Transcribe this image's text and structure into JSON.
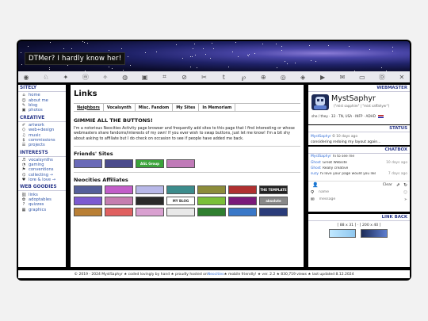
{
  "banner": {
    "title": "DTMer? I hardly know her!"
  },
  "iconbar": {
    "icons": [
      "globe-icon",
      "rabbit-icon",
      "butterfly-icon",
      "mastodon-icon",
      "twitter-icon",
      "dog-icon",
      "camera-icon",
      "crop-icon",
      "no-entry-icon",
      "scissors-icon",
      "tumblr-icon",
      "p-icon",
      "link-icon",
      "github-icon",
      "steam-icon",
      "youtube-icon",
      "chat-icon",
      "monitor-icon",
      "bell-icon",
      "x-icon"
    ],
    "glyphs": [
      "◉",
      "♘",
      "✦",
      "ⓜ",
      "✧",
      "◍",
      "▣",
      "⌗",
      "⊘",
      "✂",
      "t",
      "℘",
      "⊕",
      "◎",
      "◈",
      "▶",
      "✉",
      "▭",
      "Ⓓ",
      "✕"
    ]
  },
  "sidebar": {
    "sections": [
      {
        "title": "SITELY",
        "items": [
          {
            "icon": "home-icon",
            "glyph": "⌂",
            "label": "home"
          },
          {
            "icon": "about-icon",
            "glyph": "☺",
            "label": "about me"
          },
          {
            "icon": "blog-icon",
            "glyph": "✎",
            "label": "blog"
          },
          {
            "icon": "photos-icon",
            "glyph": "▣",
            "label": "photos"
          }
        ]
      },
      {
        "title": "CREATIVE",
        "items": [
          {
            "icon": "brush-icon",
            "glyph": "✐",
            "label": "artwork"
          },
          {
            "icon": "code-icon",
            "glyph": "⟨⟩",
            "label": "web+design"
          },
          {
            "icon": "music-icon",
            "glyph": "♫",
            "label": "music"
          },
          {
            "icon": "dollar-icon",
            "glyph": "$",
            "label": "commissions"
          },
          {
            "icon": "projects-icon",
            "glyph": "☰",
            "label": "projects"
          }
        ]
      },
      {
        "title": "INTERESTS",
        "items": [
          {
            "icon": "headphones-icon",
            "glyph": "♬",
            "label": "vocalsynths"
          },
          {
            "icon": "gamepad-icon",
            "glyph": "◔",
            "label": "gaming"
          },
          {
            "icon": "convention-icon",
            "glyph": "⚑",
            "label": "conventions"
          },
          {
            "icon": "collecting-icon",
            "glyph": "⌬",
            "label": "collecting →"
          },
          {
            "icon": "heart-icon",
            "glyph": "♥",
            "label": "lore & love →"
          }
        ]
      },
      {
        "title": "WEB GOODIES",
        "items": [
          {
            "icon": "links-icon",
            "glyph": "⛓",
            "label": "links"
          },
          {
            "icon": "adoptables-icon",
            "glyph": "✿",
            "label": "adoptables"
          },
          {
            "icon": "quizzes-icon",
            "glyph": "?",
            "label": "quizzes"
          },
          {
            "icon": "graphics-icon",
            "glyph": "▦",
            "label": "graphics"
          }
        ]
      }
    ]
  },
  "main": {
    "title": "Links",
    "tabs": [
      "Neighbors",
      "Vocalsynth",
      "Misc. Fandom",
      "My Sites",
      "In Memoriam"
    ],
    "heading": "GIMMIE ALL THE BUTTONS!",
    "para": "I'm a notorious Neocities Activity page browser and frequently add sites to this page that I find interesting or whose webmasters share fandoms/interests of my own! If you ever wish to swap buttons, just let me know! I'm a bit shy about asking to affiliate but I do check on occasion to see if people have added me back.",
    "friends_title": "Friends' Sites",
    "friends_buttons": [
      {
        "label": "",
        "color": "#6a6ab8"
      },
      {
        "label": "",
        "color": "#4b4b8c"
      },
      {
        "label": "AGL Group",
        "color": "#3aa33a"
      },
      {
        "label": "",
        "color": "#c07ab8"
      }
    ],
    "affiliates_title": "Neocities Affiliates",
    "affiliates_rows": [
      [
        {
          "label": "",
          "color": "#555f9a"
        },
        {
          "label": "",
          "color": "#c25ec9"
        },
        {
          "label": "",
          "color": "#b8b8e8"
        },
        {
          "label": "",
          "color": "#3c8c8c"
        },
        {
          "label": "",
          "color": "#8c8c3a"
        },
        {
          "label": "",
          "color": "#b03030"
        },
        {
          "label": "THE TEMPLATE",
          "color": "#222222"
        }
      ],
      [
        {
          "label": "",
          "color": "#7c5ad0"
        },
        {
          "label": "",
          "color": "#c57eb0"
        },
        {
          "label": "",
          "color": "#2a2a2a"
        },
        {
          "label": "MY BLOG",
          "color": "#ffffff"
        },
        {
          "label": "",
          "color": "#7abf38"
        },
        {
          "label": "",
          "color": "#7a1a7a"
        },
        {
          "label": "absolute",
          "color": "#888888"
        }
      ],
      [
        {
          "label": "",
          "color": "#b97f35"
        },
        {
          "label": "",
          "color": "#e06060"
        },
        {
          "label": "",
          "color": "#d9a0d0"
        },
        {
          "label": "",
          "color": "#e9e9e9"
        },
        {
          "label": "",
          "color": "#2f7f2f"
        },
        {
          "label": "",
          "color": "#3a78c8"
        },
        {
          "label": "",
          "color": "#2a3c7a"
        }
      ]
    ]
  },
  "webmaster": {
    "header": "WEBMASTER",
    "name": "MystSaphyr",
    "subtitle": "(\"mist sapphire\" | \"mist saffahyer\")",
    "tags": "she / they · 33 · TN, USA · INFP · ADHD"
  },
  "status": {
    "header": "STATUS",
    "user": "MystSaphyr",
    "time": "10 days ago",
    "text": "considering redoing my layout again..."
  },
  "chatbox": {
    "header": "CHATBOX",
    "messages": [
      {
        "user": "MystSaphyr",
        "text": "hi to see me",
        "time": ""
      },
      {
        "user": "Ghost",
        "text": "Great Website",
        "time": "10 days ago"
      },
      {
        "user": "Ghost",
        "text": "Really creative",
        "time": ""
      },
      {
        "user": "suzy",
        "text": "hi love your page would you like to exchange links by any chance??",
        "time": "7 days ago"
      }
    ],
    "name_placeholder": "name",
    "message_placeholder": "message",
    "clear_label": "Clear"
  },
  "linkback": {
    "header": "LINK BACK",
    "sizes": "[ 88 x 31 ]  ·  [ 200 x 40 ]"
  },
  "footer": {
    "text_a": "© 2019 - 2024 MystSaphyr  ★  coded lovingly by hand  ★  proudly hosted on ",
    "link": "Neocities",
    "text_b": "  ★  mobile friendly!  ★  ver. 2.2  ★  830,719 views  ★  last updated 8.12.2024"
  }
}
